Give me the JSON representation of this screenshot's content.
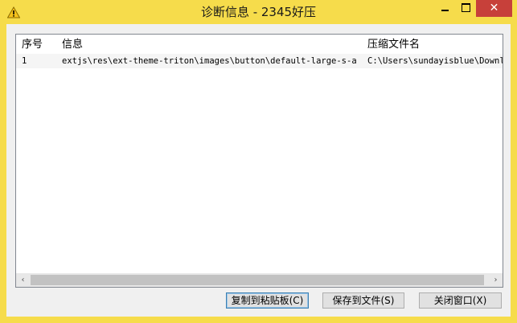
{
  "window": {
    "title": "诊断信息 - 2345好压",
    "icon": "warning-icon",
    "controls": {
      "minimize": "minimize-icon",
      "maximize": "maximize-icon",
      "close": "✕"
    }
  },
  "grid": {
    "columns": [
      "序号",
      "信息",
      "压缩文件名"
    ],
    "rows": [
      {
        "index": "1",
        "info": "extjs\\res\\ext-theme-triton\\images\\button\\default-large-s-a...",
        "archive": "C:\\Users\\sundayisblue\\Downlo"
      }
    ]
  },
  "scrollbar": {
    "left_arrow": "‹",
    "right_arrow": "›"
  },
  "buttons": {
    "copy": "复制到粘贴板(C)",
    "save": "保存到文件(S)",
    "close": "关闭窗口(X)"
  },
  "colors": {
    "frame": "#f6dc4b",
    "close_button": "#c7403a",
    "focus_border": "#3c7fb1"
  }
}
